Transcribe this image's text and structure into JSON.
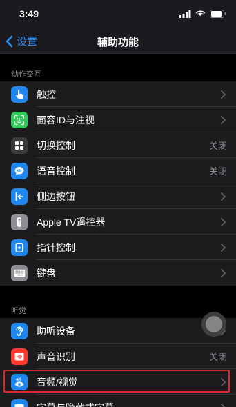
{
  "status_bar": {
    "time": "3:49"
  },
  "nav": {
    "back_label": "设置",
    "title": "辅助功能"
  },
  "sections": [
    {
      "header": "动作交互",
      "items": [
        {
          "label": "触控",
          "value": "",
          "icon": "hand-point-icon",
          "color": "#1e88f0"
        },
        {
          "label": "面容ID与注视",
          "value": "",
          "icon": "face-id-icon",
          "color": "#34c759"
        },
        {
          "label": "切换控制",
          "value": "关闭",
          "icon": "switch-control-icon",
          "color": "#3a3a3c"
        },
        {
          "label": "语音控制",
          "value": "关闭",
          "icon": "voice-control-icon",
          "color": "#1e88f0"
        },
        {
          "label": "侧边按钮",
          "value": "",
          "icon": "side-button-icon",
          "color": "#1e88f0"
        },
        {
          "label": "Apple TV遥控器",
          "value": "",
          "icon": "remote-icon",
          "color": "#8e8e93"
        },
        {
          "label": "指针控制",
          "value": "",
          "icon": "pointer-icon",
          "color": "#1e88f0"
        },
        {
          "label": "键盘",
          "value": "",
          "icon": "keyboard-icon",
          "color": "#8e8e93"
        }
      ]
    },
    {
      "header": "听觉",
      "items": [
        {
          "label": "助听设备",
          "value": "",
          "icon": "ear-icon",
          "color": "#1e88f0"
        },
        {
          "label": "声音识别",
          "value": "关闭",
          "icon": "sound-recognition-icon",
          "color": "#ff3b30"
        },
        {
          "label": "音频/视觉",
          "value": "",
          "icon": "audio-visual-icon",
          "color": "#1e88f0"
        },
        {
          "label": "字幕与隐藏式字幕",
          "value": "",
          "icon": "subtitles-icon",
          "color": "#1e88f0"
        }
      ]
    }
  ]
}
